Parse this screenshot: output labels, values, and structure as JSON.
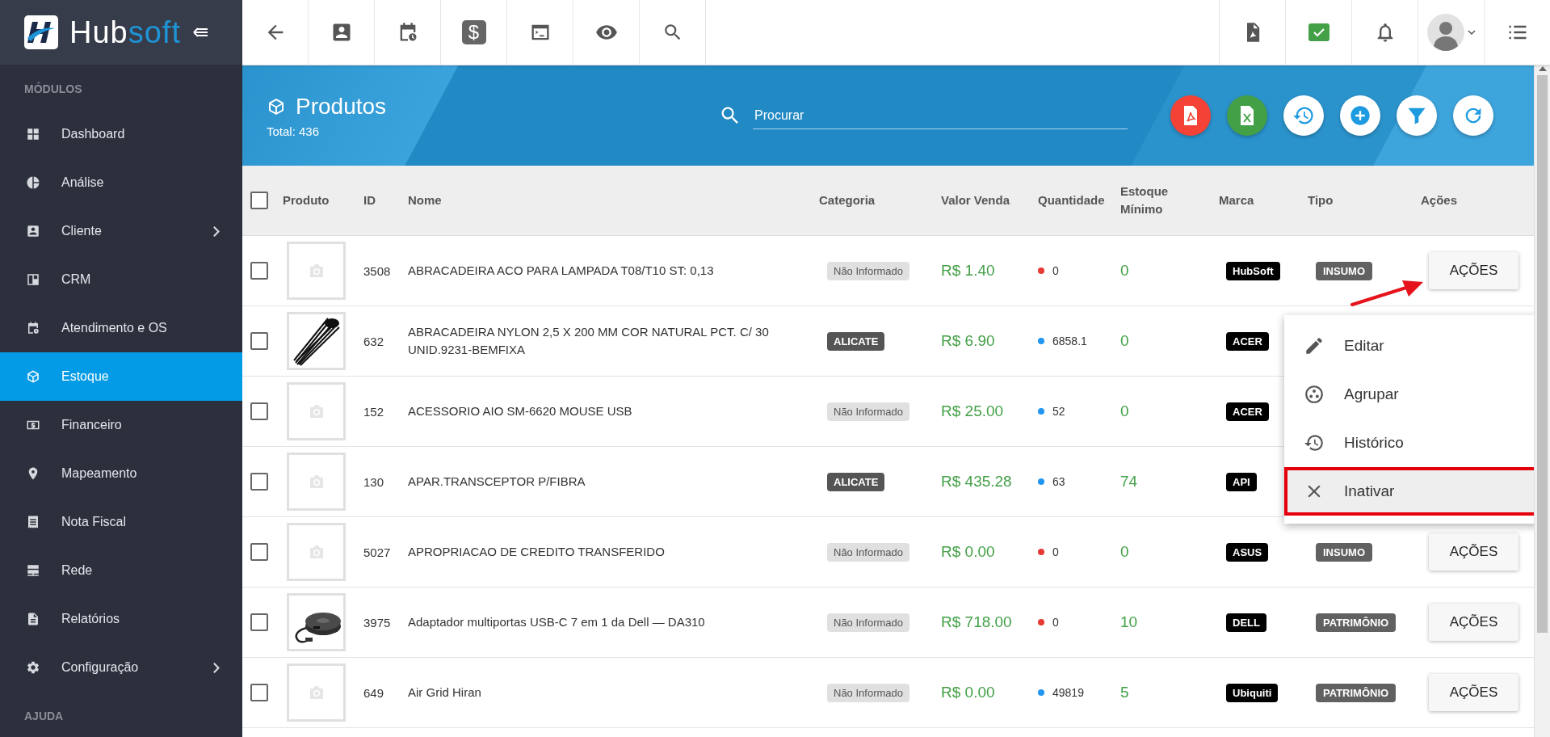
{
  "logo": {
    "primary": "Hub",
    "accent": "soft"
  },
  "sidebar": {
    "section": "MÓDULOS",
    "items": [
      {
        "kind": "dashboard",
        "label": "Dashboard",
        "selected": false,
        "submenu": false
      },
      {
        "kind": "pie",
        "label": "Análise",
        "selected": false,
        "submenu": false
      },
      {
        "kind": "contact",
        "label": "Cliente",
        "selected": false,
        "submenu": true
      },
      {
        "kind": "board",
        "label": "CRM",
        "selected": false,
        "submenu": false
      },
      {
        "kind": "calendar",
        "label": "Atendimento e OS",
        "selected": false,
        "submenu": false
      },
      {
        "kind": "cube",
        "label": "Estoque",
        "selected": true,
        "submenu": false
      },
      {
        "kind": "money",
        "label": "Financeiro",
        "selected": false,
        "submenu": false
      },
      {
        "kind": "pin",
        "label": "Mapeamento",
        "selected": false,
        "submenu": false
      },
      {
        "kind": "receipt",
        "label": "Nota Fiscal",
        "selected": false,
        "submenu": false
      },
      {
        "kind": "server",
        "label": "Rede",
        "selected": false,
        "submenu": false
      },
      {
        "kind": "document",
        "label": "Relatórios",
        "selected": false,
        "submenu": false
      },
      {
        "kind": "gear",
        "label": "Configuração",
        "selected": false,
        "submenu": true
      }
    ],
    "section_2": "AJUDA"
  },
  "toolbar": {
    "left": [
      {
        "kind": "back"
      },
      {
        "kind": "contact"
      },
      {
        "kind": "calendar"
      },
      {
        "kind": "dollar",
        "glyph": "$"
      },
      {
        "kind": "terminal"
      },
      {
        "kind": "eye"
      },
      {
        "kind": "search"
      }
    ],
    "right": [
      {
        "kind": "pdf"
      },
      {
        "kind": "chat"
      },
      {
        "kind": "bell"
      },
      {
        "kind": "avatar"
      },
      {
        "kind": "list"
      }
    ]
  },
  "page_header": {
    "title": "Produtos",
    "total": "Total: 436",
    "search": {
      "placeholder": "Procurar"
    },
    "actions": [
      {
        "kind": "pdf"
      },
      {
        "kind": "excel"
      },
      {
        "kind": "history"
      },
      {
        "kind": "add"
      },
      {
        "kind": "filter"
      },
      {
        "kind": "refresh"
      }
    ]
  },
  "table": {
    "select_all": {
      "checked": false
    },
    "columns": [
      "Produto",
      "ID",
      "Nome",
      "Categoria",
      "Valor Venda",
      "Quantidade",
      "Estoque Mínimo",
      "Marca",
      "Tipo",
      "Ações"
    ],
    "rows": [
      {
        "checked": false,
        "image": {
          "kind": "placeholder"
        },
        "id": "3508",
        "name": "ABRACADEIRA ACO PARA LAMPADA T08/T10 ST: 0,13",
        "category": {
          "label": "Não Informado",
          "kind": "empty"
        },
        "price": "R$ 1.40",
        "quantity": "0",
        "color": "#e53935",
        "minimum": "0",
        "brand": "HubSoft",
        "type": "INSUMO",
        "action": "AÇÕES"
      },
      {
        "checked": false,
        "image": {
          "kind": "ties"
        },
        "id": "632",
        "name": "ABRACADEIRA NYLON 2,5 X 200 MM COR NATURAL PCT. C/ 30 UNID.9231-BEMFIXA",
        "category": {
          "label": "ALICATE",
          "kind": "set"
        },
        "price": "R$ 6.90",
        "quantity": "6858.1",
        "color": "#2196f3",
        "minimum": "0",
        "brand": "ACER"
      },
      {
        "checked": false,
        "image": {
          "kind": "placeholder"
        },
        "id": "152",
        "name": "ACESSORIO AIO SM-6620 MOUSE USB",
        "category": {
          "label": "Não Informado",
          "kind": "empty"
        },
        "price": "R$ 25.00",
        "quantity": "52",
        "color": "#2196f3",
        "minimum": "0",
        "brand": "ACER"
      },
      {
        "checked": false,
        "image": {
          "kind": "placeholder"
        },
        "id": "130",
        "name": "APAR.TRANSCEPTOR P/FIBRA",
        "category": {
          "label": "ALICATE",
          "kind": "set"
        },
        "price": "R$ 435.28",
        "quantity": "63",
        "color": "#2196f3",
        "minimum": "74",
        "brand": "API"
      },
      {
        "checked": false,
        "image": {
          "kind": "placeholder"
        },
        "id": "5027",
        "name": "APROPRIACAO DE CREDITO TRANSFERIDO",
        "category": {
          "label": "Não Informado",
          "kind": "empty"
        },
        "price": "R$ 0.00",
        "quantity": "0",
        "color": "#e53935",
        "minimum": "0",
        "brand": "ASUS",
        "type": "INSUMO",
        "action": "AÇÕES"
      },
      {
        "checked": false,
        "image": {
          "kind": "hub"
        },
        "id": "3975",
        "name": "Adaptador multiportas USB-C 7 em 1 da Dell — DA310",
        "category": {
          "label": "Não Informado",
          "kind": "empty"
        },
        "price": "R$ 718.00",
        "quantity": "0",
        "color": "#e53935",
        "minimum": "10",
        "brand": "DELL",
        "type": "PATRIMÔNIO",
        "action": "AÇÕES"
      },
      {
        "checked": false,
        "image": {
          "kind": "placeholder"
        },
        "id": "649",
        "name": "Air Grid Hiran",
        "category": {
          "label": "Não Informado",
          "kind": "empty"
        },
        "price": "R$ 0.00",
        "quantity": "49819",
        "color": "#2196f3",
        "minimum": "5",
        "brand": "Ubiquiti",
        "type": "PATRIMÔNIO",
        "action": "AÇÕES"
      }
    ]
  },
  "menu": {
    "items": [
      {
        "kind": "edit",
        "label": "Editar",
        "selected": false,
        "outlined": false
      },
      {
        "kind": "group",
        "label": "Agrupar",
        "selected": false,
        "outlined": false
      },
      {
        "kind": "history",
        "label": "Histórico",
        "selected": false,
        "outlined": false
      },
      {
        "kind": "close",
        "label": "Inativar",
        "selected": true,
        "outlined": true
      }
    ]
  }
}
